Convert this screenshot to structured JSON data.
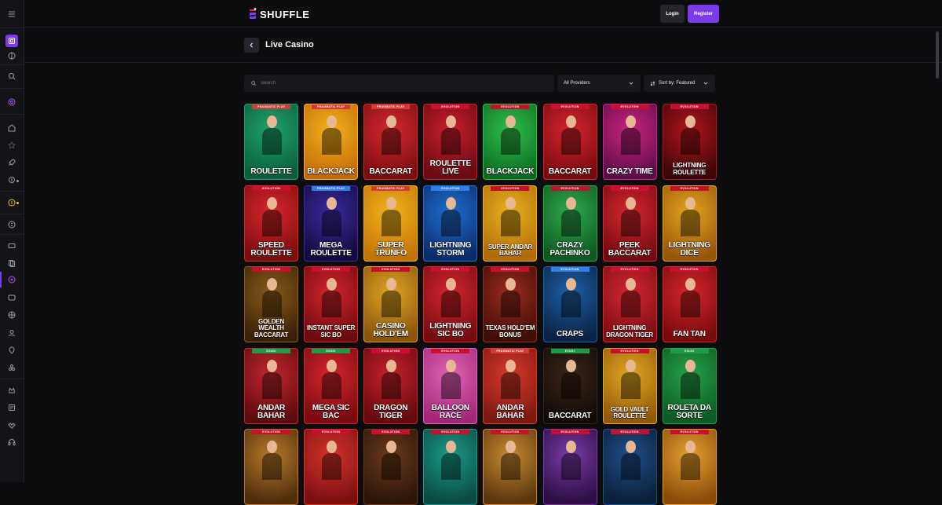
{
  "header": {
    "logo_text": "SHUFFLE",
    "login_label": "Login",
    "register_label": "Register"
  },
  "page": {
    "title": "Live Casino"
  },
  "filters": {
    "search_placeholder": "Search",
    "providers_value": "All Providers",
    "sort_value": "Sort by: Featured"
  },
  "colors": {
    "accent": "#7c3aed",
    "background": "#0d0d10",
    "pragmatic_badge": "#d43a3a",
    "evolution_badge": "#c8102e",
    "pragmatic_blue_badge": "#2f7fe6"
  },
  "sidebar": {
    "icons": [
      "menu-icon",
      "casino-icon",
      "sports-icon",
      "search-icon",
      "chip-icon",
      "home-icon",
      "star-icon",
      "rocket-icon",
      "promo-icon",
      "coin-icon",
      "currency-icon",
      "slots-icon",
      "cards-icon",
      "live-icon",
      "table-games-icon",
      "wheel-icon",
      "user-icon",
      "game-shows-icon",
      "providers-icon",
      "vip-icon",
      "blog-icon",
      "partner-icon",
      "support-icon"
    ]
  },
  "games": [
    {
      "name": "Roulette",
      "provider": "PRAGMATIC PLAY"
    },
    {
      "name": "Blackjack",
      "provider": "PRAGMATIC PLAY"
    },
    {
      "name": "Baccarat",
      "provider": "PRAGMATIC PLAY"
    },
    {
      "name": "Roulette Live",
      "provider": "EVOLUTION"
    },
    {
      "name": "Blackjack",
      "provider": "EVOLUTION"
    },
    {
      "name": "Baccarat",
      "provider": "EVOLUTION"
    },
    {
      "name": "Crazy Time",
      "provider": "EVOLUTION"
    },
    {
      "name": "Lightning Roulette",
      "provider": "EVOLUTION"
    },
    {
      "name": "Speed Roulette",
      "provider": "EVOLUTION"
    },
    {
      "name": "Mega Roulette",
      "provider": "PRAGMATIC PLAY"
    },
    {
      "name": "Super Trunfo",
      "provider": "PRAGMATIC PLAY"
    },
    {
      "name": "Lightning Storm",
      "provider": "EVOLUTION"
    },
    {
      "name": "Super Andar Bahar",
      "provider": "EVOLUTION"
    },
    {
      "name": "Crazy Pachinko",
      "provider": "EVOLUTION"
    },
    {
      "name": "Peek Baccarat",
      "provider": "EVOLUTION"
    },
    {
      "name": "Lightning Dice",
      "provider": "EVOLUTION"
    },
    {
      "name": "Golden Wealth Baccarat",
      "provider": "EVOLUTION"
    },
    {
      "name": "Instant Super Sic Bo",
      "provider": "EVOLUTION"
    },
    {
      "name": "Casino Hold'em",
      "provider": "EVOLUTION"
    },
    {
      "name": "Lightning Sic Bo",
      "provider": "EVOLUTION"
    },
    {
      "name": "Texas Hold'em Bonus",
      "provider": "EVOLUTION"
    },
    {
      "name": "Craps",
      "provider": "EVOLUTION"
    },
    {
      "name": "Lightning Dragon Tiger",
      "provider": "EVOLUTION"
    },
    {
      "name": "Fan Tan",
      "provider": "EVOLUTION"
    },
    {
      "name": "Andar Bahar",
      "provider": "EZUGI"
    },
    {
      "name": "Mega Sic Bac",
      "provider": "EZUGI"
    },
    {
      "name": "Dragon Tiger",
      "provider": "EVOLUTION"
    },
    {
      "name": "Balloon Race",
      "provider": "EVOLUTION"
    },
    {
      "name": "Andar Bahar",
      "provider": "PRAGMATIC PLAY"
    },
    {
      "name": "Baccarat",
      "provider": "EZUGI"
    },
    {
      "name": "Gold Vault Roulette",
      "provider": "EVOLUTION"
    },
    {
      "name": "Roleta da Sorte",
      "provider": "EZUGI"
    },
    {
      "name": "",
      "provider": "EVOLUTION"
    },
    {
      "name": "",
      "provider": "EVOLUTION"
    },
    {
      "name": "",
      "provider": "EVOLUTION"
    },
    {
      "name": "",
      "provider": "EVOLUTION"
    },
    {
      "name": "",
      "provider": "EVOLUTION"
    },
    {
      "name": "",
      "provider": "EVOLUTION"
    },
    {
      "name": "",
      "provider": "EVOLUTION"
    },
    {
      "name": "",
      "provider": "EVOLUTION"
    }
  ]
}
